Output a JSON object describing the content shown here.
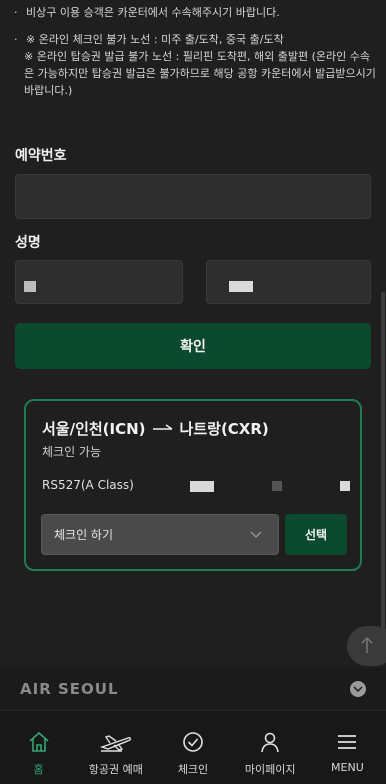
{
  "notice": {
    "line1": "비상구 이용 승객은 카운터에서 수속해주시기 바랍니다.",
    "line2": "※ 온라인 체크인 불가 노선 : 미주 출/도착, 중국 출/도착",
    "line3": "※ 온라인 탑승권 발급 불가 노선 : 필리핀 도착편, 해외 출발편 (온라인 수속은 가능하지만 탑승권 발급은 불가하므로 해당 공항 카운터에서 발급받으시기 바랍니다.)"
  },
  "form": {
    "reservation_label": "예약번호",
    "name_label": "성명",
    "confirm_label": "확인"
  },
  "card": {
    "origin": "서울/인천(ICN)",
    "destination": "나트랑(CXR)",
    "status": "체크인 가능",
    "flight": "RS527(A Class)",
    "select_value": "체크인 하기",
    "select_button": "선택"
  },
  "footer": {
    "logo": "AIR SEOUL"
  },
  "nav": {
    "items": [
      {
        "label": "홈",
        "icon": "home-icon"
      },
      {
        "label": "항공권 예매",
        "icon": "plane-icon"
      },
      {
        "label": "체크인",
        "icon": "check-circle-icon"
      },
      {
        "label": "마이페이지",
        "icon": "user-icon"
      },
      {
        "label": "MENU",
        "icon": "menu-icon"
      }
    ]
  },
  "colors": {
    "accent_green": "#0b4a2e",
    "active_green": "#2fa873",
    "card_border": "#1e7d54"
  }
}
